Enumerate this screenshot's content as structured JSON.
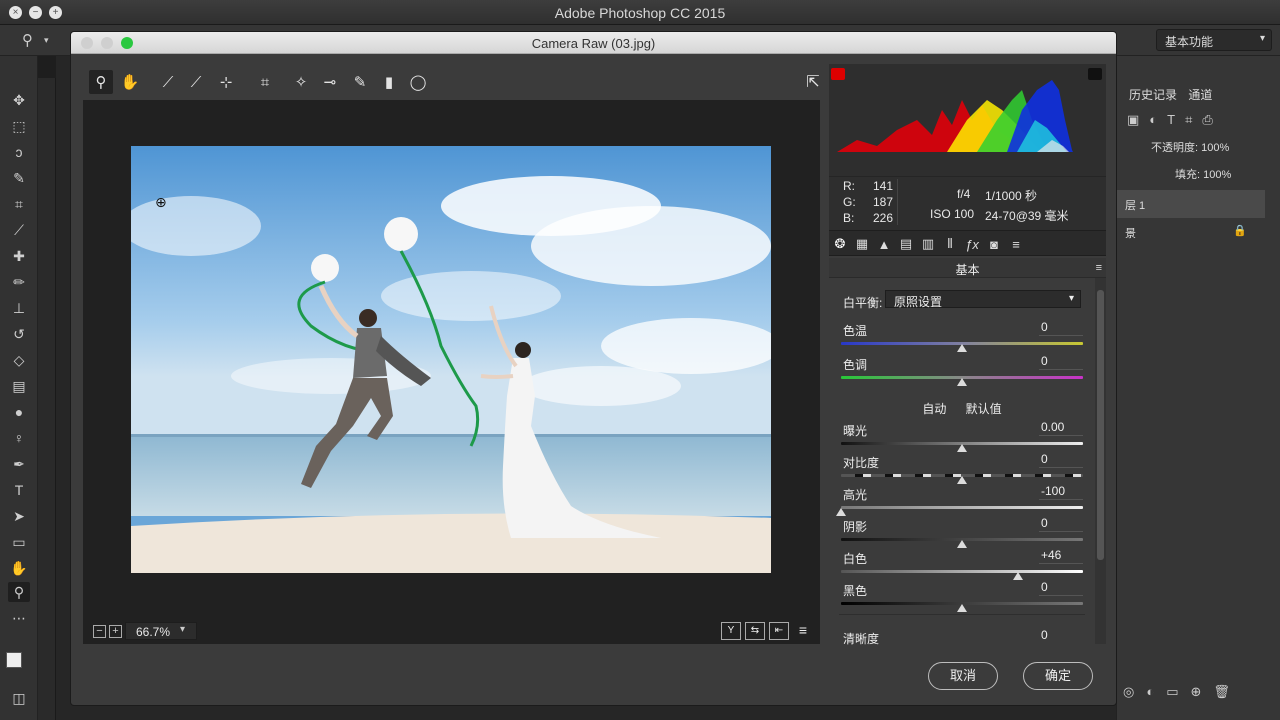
{
  "app": {
    "title": "Adobe Photoshop CC 2015",
    "workspace": "基本功能"
  },
  "ps_panel": {
    "tabs": [
      "历史记录",
      "通道"
    ],
    "opacity_label": "不透明度:",
    "opacity_value": "100%",
    "fill_label": "填充:",
    "fill_value": "100%",
    "layer1": "层 1",
    "layer_bg": "景"
  },
  "dialog": {
    "title": "Camera Raw (03.jpg)",
    "zoom": "66.7%",
    "cancel_label": "取消",
    "ok_label": "确定",
    "view_buttons": [
      "Y",
      "⇆",
      "⇤",
      "≡"
    ]
  },
  "info": {
    "r_label": "R:",
    "r_value": "141",
    "g_label": "G:",
    "g_value": "187",
    "b_label": "B:",
    "b_value": "226",
    "aperture": "f/4",
    "shutter": "1/1000 秒",
    "iso": "ISO 100",
    "lens": "24-70@39 毫米"
  },
  "panel": {
    "section_title": "基本",
    "wb_label": "白平衡:",
    "wb_value": "原照设置",
    "auto_label": "自动",
    "default_label": "默认值",
    "sliders": {
      "temp": {
        "label": "色温",
        "value": "0",
        "pos": 0.5
      },
      "tint": {
        "label": "色调",
        "value": "0",
        "pos": 0.5
      },
      "exposure": {
        "label": "曝光",
        "value": "0.00",
        "pos": 0.5
      },
      "contrast": {
        "label": "对比度",
        "value": "0",
        "pos": 0.5
      },
      "highlights": {
        "label": "高光",
        "value": "-100",
        "pos": 0.0
      },
      "shadows": {
        "label": "阴影",
        "value": "0",
        "pos": 0.5
      },
      "whites": {
        "label": "白色",
        "value": "+46",
        "pos": 0.73
      },
      "blacks": {
        "label": "黑色",
        "value": "0",
        "pos": 0.5
      },
      "clarity": {
        "label": "清晰度",
        "value": "0",
        "pos": 0.5
      }
    }
  },
  "colors": {
    "accent_temp": "#c8c832",
    "accent_tint": "#c832c8",
    "sky": "#6aa6d8"
  }
}
